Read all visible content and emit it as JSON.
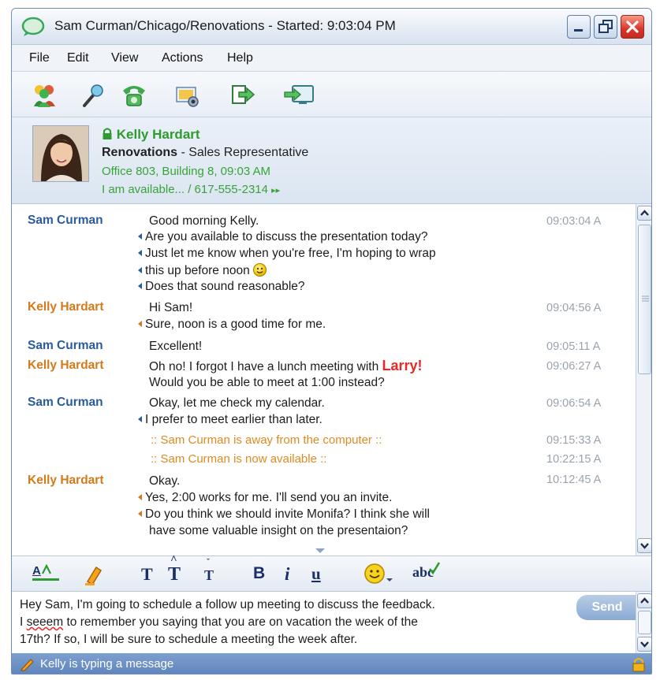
{
  "window": {
    "title": "Sam Curman/Chicago/Renovations - Started: 9:03:04 PM"
  },
  "menu": [
    "File",
    "Edit",
    "View",
    "Actions",
    "Help"
  ],
  "toolbar": {
    "icons": [
      "people-icon",
      "microphone-icon",
      "phone-icon",
      "screen-share-icon",
      "transfer-icon",
      "display-icon"
    ]
  },
  "contact": {
    "name": "Kelly Hardart",
    "company": "Renovations",
    "title": " - Sales Representative",
    "office": "Office 803, Building 8, 09:03 AM",
    "status": "I am available... / 617-555-2314",
    "status_arrow": "▸▸"
  },
  "messages": [
    {
      "sender": "Sam Curman",
      "who": "sam",
      "time": "09:03:04 A",
      "lines": [
        "Good morning Kelly.",
        "Are you available to discuss the presentation today?",
        "Just let me know when you're free, I'm hoping to wrap",
        "this up before noon",
        "Does that sound reasonable?"
      ]
    },
    {
      "sender": "Kelly Hardart",
      "who": "kelly",
      "time": "09:04:56 A",
      "lines": [
        "Hi Sam!",
        "Sure, noon is a good time for me."
      ]
    },
    {
      "sender": "Sam Curman",
      "who": "sam",
      "time": "09:05:11 A",
      "lines": [
        "Excellent!"
      ]
    },
    {
      "sender": "Kelly Hardart",
      "who": "kelly",
      "time": "09:06:27 A",
      "lines": [
        "Oh no! I forgot I have a lunch meeting with ",
        "Would you be able to meet at 1:00 instead?"
      ],
      "highlight": "Larry!"
    },
    {
      "sender": "Sam Curman",
      "who": "sam",
      "time": "09:06:54 A",
      "lines": [
        "Okay, let me check my calendar.",
        "I prefer to meet earlier than later."
      ]
    },
    {
      "system": ":: Sam Curman is away from the computer ::",
      "time": "09:15:33 A"
    },
    {
      "system": ":: Sam Curman is now available ::",
      "time": "10:22:15 A"
    },
    {
      "sender": "Kelly Hardart",
      "who": "kelly",
      "time": "10:12:45 A",
      "lines": [
        "Okay.",
        "Yes, 2:00 works for me. I'll send you an invite.",
        "Do you think we should invite Monifa? I think she will",
        "have some valuable insight on the presentaion?"
      ]
    }
  ],
  "format_toolbar": {
    "text_color": "A",
    "bold": "B",
    "italic": "i",
    "underline": "u",
    "font_t": "T",
    "spell": "abc"
  },
  "compose": {
    "line1": "Hey Sam, I'm going to schedule a follow up meeting to discuss the feedback.",
    "line2_pre": "I ",
    "line2_miss": "seeem",
    "line2_post": " to remember you saying that you are on vacation the week of the",
    "line3": "17th? If so, I will be sure to schedule a meeting the week after.",
    "send_label": "Send"
  },
  "status": {
    "text": "Kelly is typing a message"
  },
  "colors": {
    "sam": "#2b5c9a",
    "kelly": "#d47a1a",
    "contact_green": "#39a339",
    "highlight_red": "#e32a2a"
  }
}
